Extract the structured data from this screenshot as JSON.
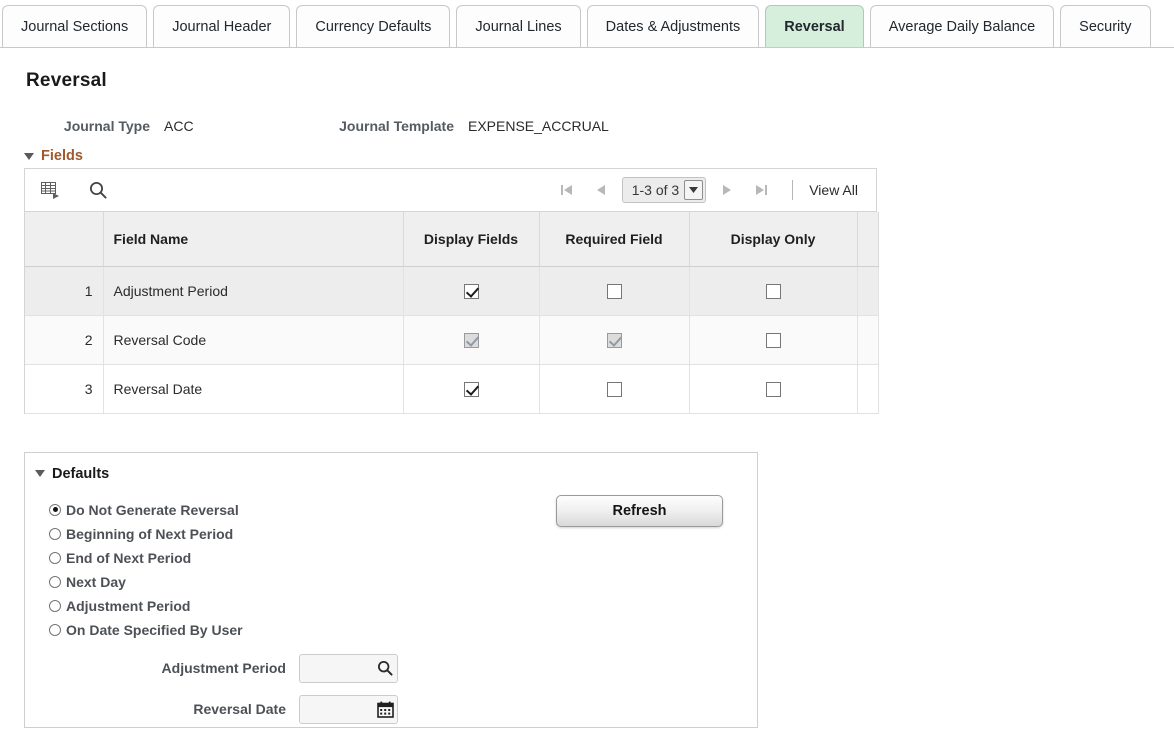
{
  "tabs": [
    {
      "label": "Journal Sections",
      "active": false
    },
    {
      "label": "Journal Header",
      "active": false
    },
    {
      "label": "Currency Defaults",
      "active": false
    },
    {
      "label": "Journal Lines",
      "active": false
    },
    {
      "label": "Dates & Adjustments",
      "active": false
    },
    {
      "label": "Reversal",
      "active": true
    },
    {
      "label": "Average Daily Balance",
      "active": false
    },
    {
      "label": "Security",
      "active": false
    }
  ],
  "page": {
    "title": "Reversal"
  },
  "header": {
    "journal_type_label": "Journal Type",
    "journal_type_value": "ACC",
    "journal_template_label": "Journal Template",
    "journal_template_value": "EXPENSE_ACCRUAL"
  },
  "fields_section": {
    "title": "Fields",
    "toolbar": {
      "personalize_icon": "grid-personalize-icon",
      "find_icon": "search-icon",
      "first_icon": "first-page-icon",
      "prev_icon": "previous-page-icon",
      "page_range": "1-3 of 3",
      "dropdown_icon": "chevron-down-icon",
      "next_icon": "next-page-icon",
      "last_icon": "last-page-icon",
      "view_all_label": "View All"
    },
    "columns": [
      "",
      "Field Name",
      "Display Fields",
      "Required Field",
      "Display Only",
      ""
    ],
    "rows": [
      {
        "num": "1",
        "name": "Adjustment Period",
        "display_fields": {
          "checked": true,
          "disabled": false
        },
        "required_field": {
          "checked": false,
          "disabled": false
        },
        "display_only": {
          "checked": false,
          "disabled": false
        }
      },
      {
        "num": "2",
        "name": "Reversal Code",
        "display_fields": {
          "checked": true,
          "disabled": true
        },
        "required_field": {
          "checked": true,
          "disabled": true
        },
        "display_only": {
          "checked": false,
          "disabled": false
        }
      },
      {
        "num": "3",
        "name": "Reversal Date",
        "display_fields": {
          "checked": true,
          "disabled": false
        },
        "required_field": {
          "checked": false,
          "disabled": false
        },
        "display_only": {
          "checked": false,
          "disabled": false
        }
      }
    ]
  },
  "defaults_section": {
    "title": "Defaults",
    "radios": [
      {
        "label": "Do Not Generate Reversal",
        "selected": true
      },
      {
        "label": "Beginning of Next Period",
        "selected": false
      },
      {
        "label": "End of Next Period",
        "selected": false
      },
      {
        "label": "Next Day",
        "selected": false
      },
      {
        "label": "Adjustment Period",
        "selected": false
      },
      {
        "label": "On Date Specified By User",
        "selected": false
      }
    ],
    "refresh_label": "Refresh",
    "adjustment_period": {
      "label": "Adjustment Period",
      "value": "",
      "placeholder": "",
      "icon": "lookup-search-icon"
    },
    "reversal_date": {
      "label": "Reversal Date",
      "value": "",
      "placeholder": "",
      "icon": "calendar-icon"
    }
  },
  "colors": {
    "active_tab_bg": "#d6efdc",
    "section_title": "#a05a2c",
    "row_shade": "#ededed",
    "header_bg": "#efefef"
  }
}
